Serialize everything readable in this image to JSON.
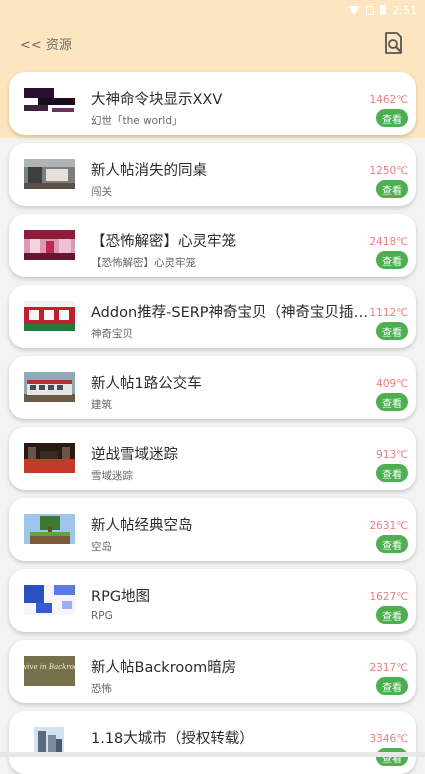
{
  "status": {
    "time": "2:51"
  },
  "header": {
    "back_label": "<< 资源"
  },
  "colors": {
    "header_bg": "#fde6bf",
    "accent_green": "#4caf50",
    "temp_red": "#ef7b7b"
  },
  "items": [
    {
      "title": "大神命令块显示XXV",
      "subtitle": "幻世「the world」",
      "temp": "1462℃",
      "button": "查看",
      "thumb": "dark-glitch"
    },
    {
      "title": "新人帖消失的同桌",
      "subtitle": "闯关",
      "temp": "1250℃",
      "button": "查看",
      "thumb": "classroom"
    },
    {
      "title": "【恐怖解密】心灵牢笼",
      "subtitle": "【恐怖解密】心灵牢笼",
      "temp": "2418℃",
      "button": "查看",
      "thumb": "pink-room"
    },
    {
      "title": "Addon推荐-SERP神奇宝贝（神奇宝贝插件...",
      "subtitle": "神奇宝贝",
      "temp": "1112℃",
      "button": "查看",
      "thumb": "pokemon"
    },
    {
      "title": "新人帖1路公交车",
      "subtitle": "建筑",
      "temp": "409℃",
      "button": "查看",
      "thumb": "bus"
    },
    {
      "title": "逆战雪域迷踪",
      "subtitle": "雪域迷踪",
      "temp": "913℃",
      "button": "查看",
      "thumb": "red-hall"
    },
    {
      "title": "新人帖经典空岛",
      "subtitle": "空岛",
      "temp": "2631℃",
      "button": "查看",
      "thumb": "skyblock"
    },
    {
      "title": "RPG地图",
      "subtitle": "RPG",
      "temp": "1627℃",
      "button": "查看",
      "thumb": "rpg"
    },
    {
      "title": "新人帖Backroom暗房",
      "subtitle": "恐怖",
      "temp": "2317℃",
      "button": "查看",
      "thumb": "backrooms",
      "thumb_text": "Survive in Backrooms"
    },
    {
      "title": "1.18大城市（授权转载）",
      "subtitle": "",
      "temp": "3346℃",
      "button": "查看",
      "thumb": "city"
    }
  ]
}
